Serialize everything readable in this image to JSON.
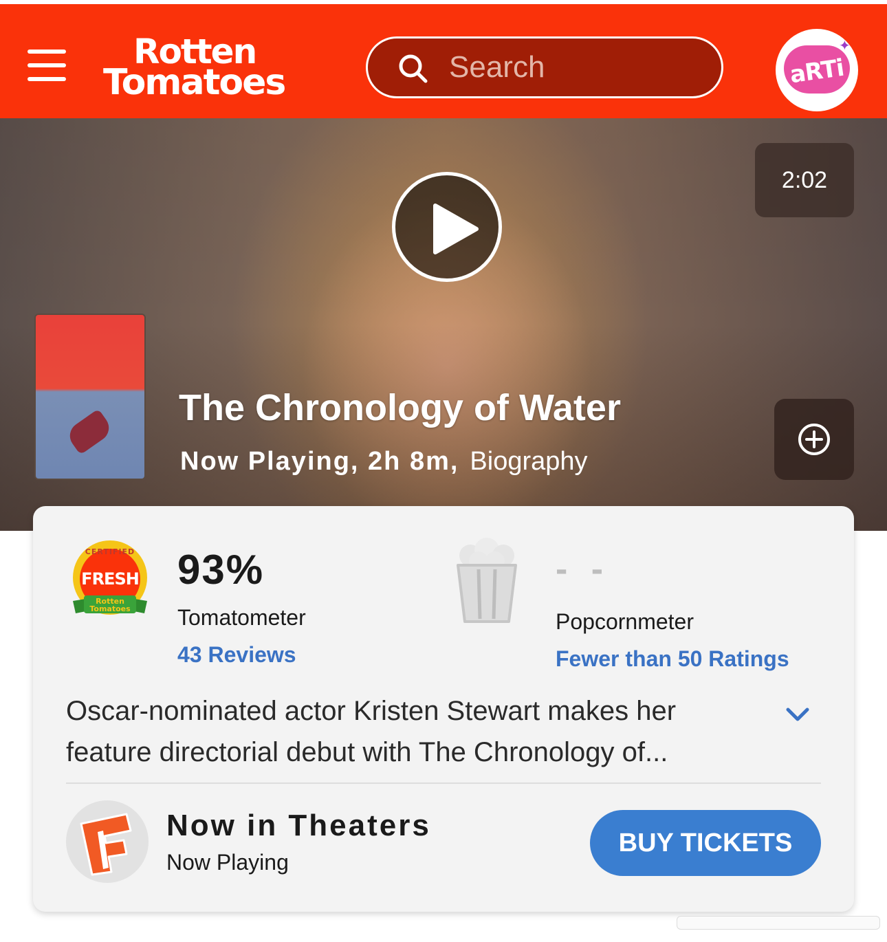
{
  "header": {
    "logo_line1": "Rotten",
    "logo_line2": "Tomatoes",
    "search_placeholder": "Search",
    "avatar_text": "aRTi",
    "brand_color": "#fa320a"
  },
  "hero": {
    "duration": "2:02",
    "title": "The Chronology of Water",
    "status_runtime": "Now Playing, 2h 8m,",
    "genre": "Biography"
  },
  "scores": {
    "badge_top": "CERTIFIED",
    "badge_main": "FRESH",
    "badge_brand_1": "Rotten",
    "badge_brand_2": "Tomatoes",
    "tomatometer_value": "93%",
    "tomatometer_label": "Tomatometer",
    "reviews_link": "43 Reviews",
    "popcornmeter_value": "- -",
    "popcornmeter_label": "Popcornmeter",
    "ratings_link": "Fewer than 50 Ratings",
    "link_color": "#3a72c4"
  },
  "synopsis": "Oscar-nominated actor Kristen Stewart makes her feature directorial debut with The Chronology of...",
  "theaters": {
    "title": "Now in Theaters",
    "subtitle": "Now Playing",
    "button": "BUY TICKETS",
    "button_color": "#3a7ed0"
  }
}
